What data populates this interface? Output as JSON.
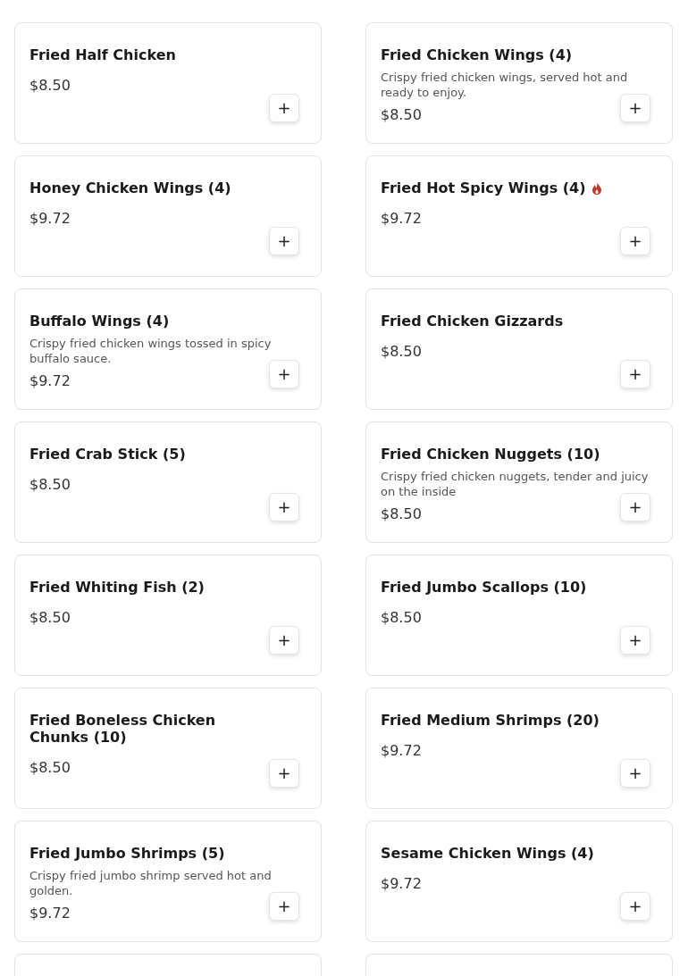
{
  "items": [
    {
      "name": "Fried Half Chicken",
      "price": "$8.50"
    },
    {
      "name": "Fried Chicken Wings (4)",
      "description": "Crispy fried chicken wings, served hot and ready to enjoy.",
      "price": "$8.50"
    },
    {
      "name": "Honey Chicken Wings (4)",
      "price": "$9.72"
    },
    {
      "name": "Fried Hot Spicy Wings (4)",
      "spicy": true,
      "price": "$9.72"
    },
    {
      "name": "Buffalo Wings (4)",
      "description": "Crispy fried chicken wings tossed in spicy buffalo sauce.",
      "price": "$9.72"
    },
    {
      "name": "Fried Chicken Gizzards",
      "price": "$8.50"
    },
    {
      "name": "Fried Crab Stick (5)",
      "price": "$8.50"
    },
    {
      "name": "Fried Chicken Nuggets (10)",
      "description": "Crispy fried chicken nuggets, tender and juicy on the inside",
      "price": "$8.50"
    },
    {
      "name": "Fried Whiting Fish (2)",
      "price": "$8.50"
    },
    {
      "name": "Fried Jumbo Scallops (10)",
      "price": "$8.50"
    },
    {
      "name": "Fried Boneless Chicken Chunks (10)",
      "price": "$8.50"
    },
    {
      "name": "Fried Medium Shrimps (20)",
      "price": "$9.72"
    },
    {
      "name": "Fried Jumbo Shrimps (5)",
      "description": "Crispy fried jumbo shrimp served hot and golden.",
      "price": "$9.72"
    },
    {
      "name": "Sesame Chicken Wings (4)",
      "price": "$9.72"
    }
  ],
  "add_button": {
    "label": "+"
  }
}
